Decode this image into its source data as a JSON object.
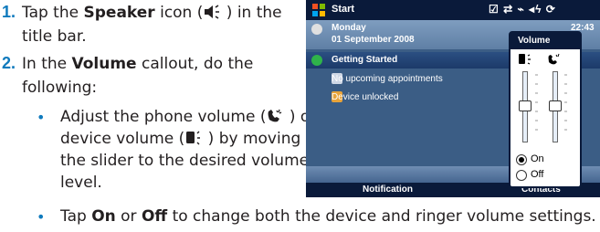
{
  "steps": [
    {
      "number": "1.",
      "text_before": "Tap the ",
      "bold": "Speaker",
      "text_after_line1": " icon (",
      "text_after_line1b": " ) in the",
      "line2": "title bar."
    },
    {
      "number": "2.",
      "line1_before": "In the ",
      "bold": "Volume",
      "line1_after": " callout, do the",
      "line2": "following:"
    }
  ],
  "bullets": {
    "b1": {
      "line1a": "Adjust the phone volume (",
      "line1b": " ) or",
      "line2a": "device volume (",
      "line2b": " ) by moving",
      "line3": "the slider to the desired volume",
      "line4": "level."
    },
    "b2": {
      "a": "Tap ",
      "on": "On",
      "mid": " or ",
      "off": "Off",
      "rest": " to change both the device and ringer volume settings."
    }
  },
  "phone": {
    "title": "Start",
    "time": "22:43",
    "date_line1": "Monday",
    "date_line2": "01 September 2008",
    "item_getting_started": "Getting Started",
    "item_appointments": "No upcoming appointments",
    "item_lock": "Device unlocked",
    "soft_left": "Notification",
    "soft_right": "Contacts",
    "callout_title": "Volume",
    "radio_on": "On",
    "radio_off": "Off",
    "radio_selected": "On",
    "device_volume_level": 0.5,
    "phone_volume_level": 0.5
  },
  "colors": {
    "accent": "#0f7abd",
    "titlebar": "#0a1a3a"
  }
}
